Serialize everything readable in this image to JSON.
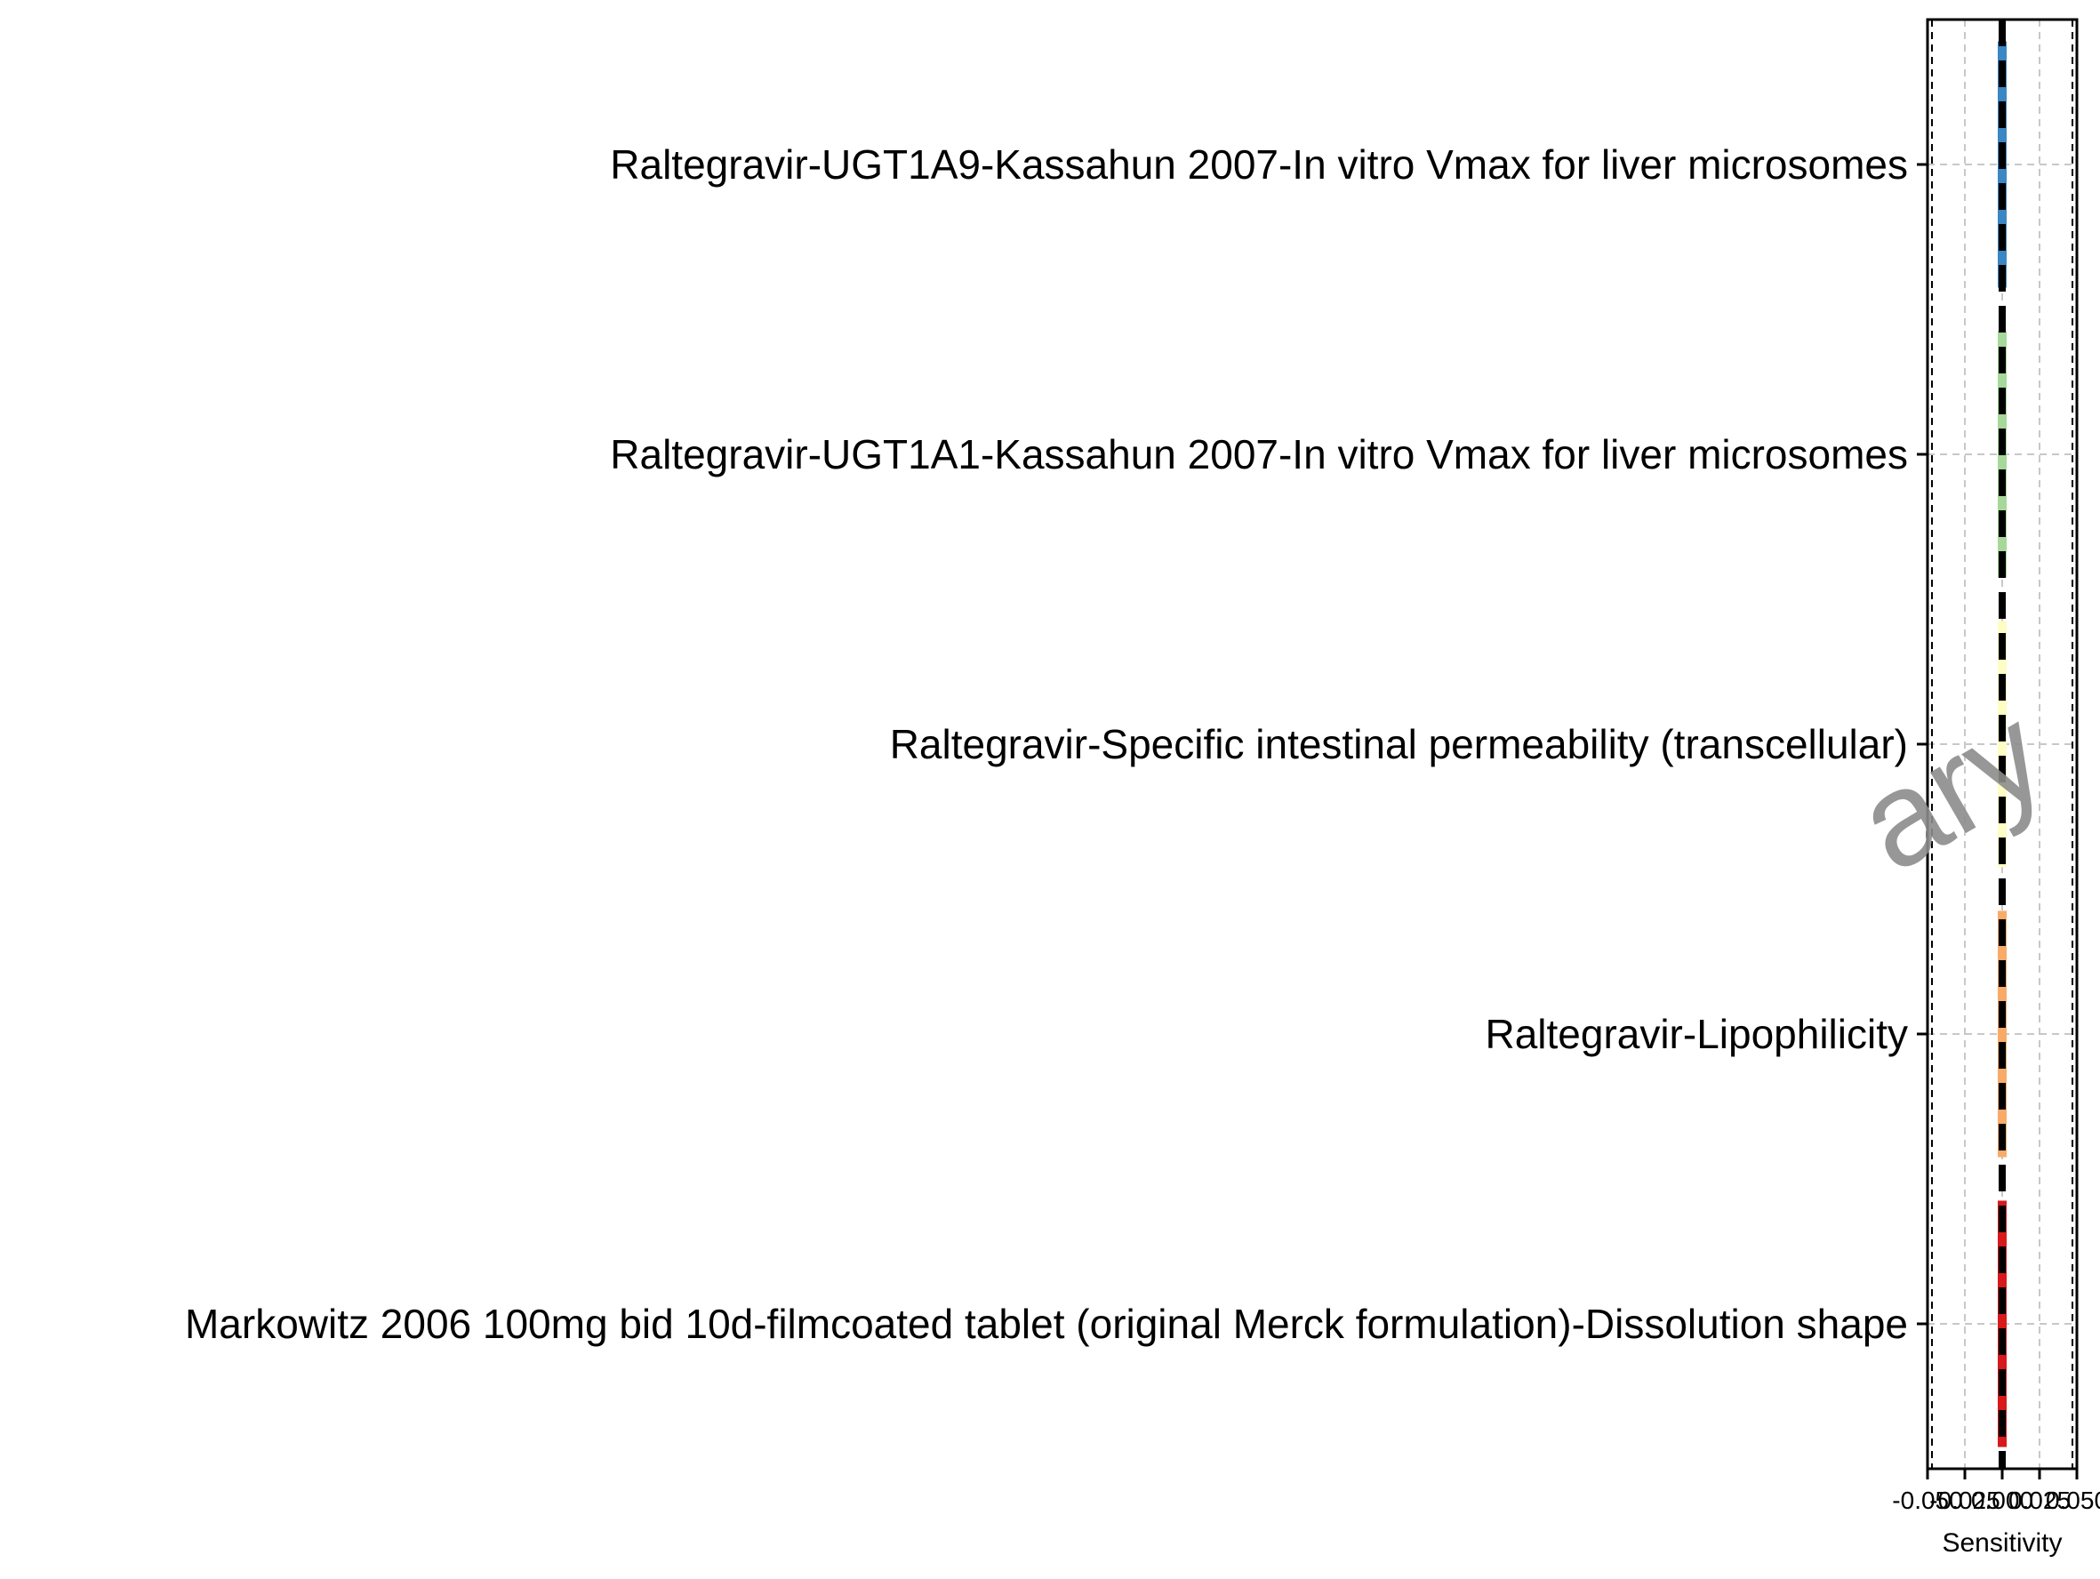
{
  "chart_data": {
    "type": "bar",
    "orientation": "horizontal",
    "xlabel": "Sensitivity",
    "xlim": [
      -0.05,
      0.05
    ],
    "xticks": [
      -0.05,
      -0.025,
      0,
      0.025,
      0.05
    ],
    "xtick_labels": [
      "-0.050",
      "-0.025",
      "0.000",
      "0.025",
      "0.050"
    ],
    "grid": true,
    "watermark": "ary",
    "zero_line": "dashed",
    "categories": [
      "Raltegravir-UGT1A9-Kassahun 2007-In vitro Vmax for liver microsomes",
      "Raltegravir-UGT1A1-Kassahun 2007-In vitro Vmax for liver microsomes",
      "Raltegravir-Specific intestinal permeability (transcellular)",
      "Raltegravir-Lipophilicity",
      "Markowitz 2006 100mg bid 10d-filmcoated tablet (original Merck formulation)-Dissolution shape"
    ],
    "values": [
      0,
      0,
      0,
      0,
      0
    ],
    "colors": [
      "#3a87c4",
      "#a6d89a",
      "#fdfdc4",
      "#f8ab69",
      "#d7191c"
    ]
  }
}
